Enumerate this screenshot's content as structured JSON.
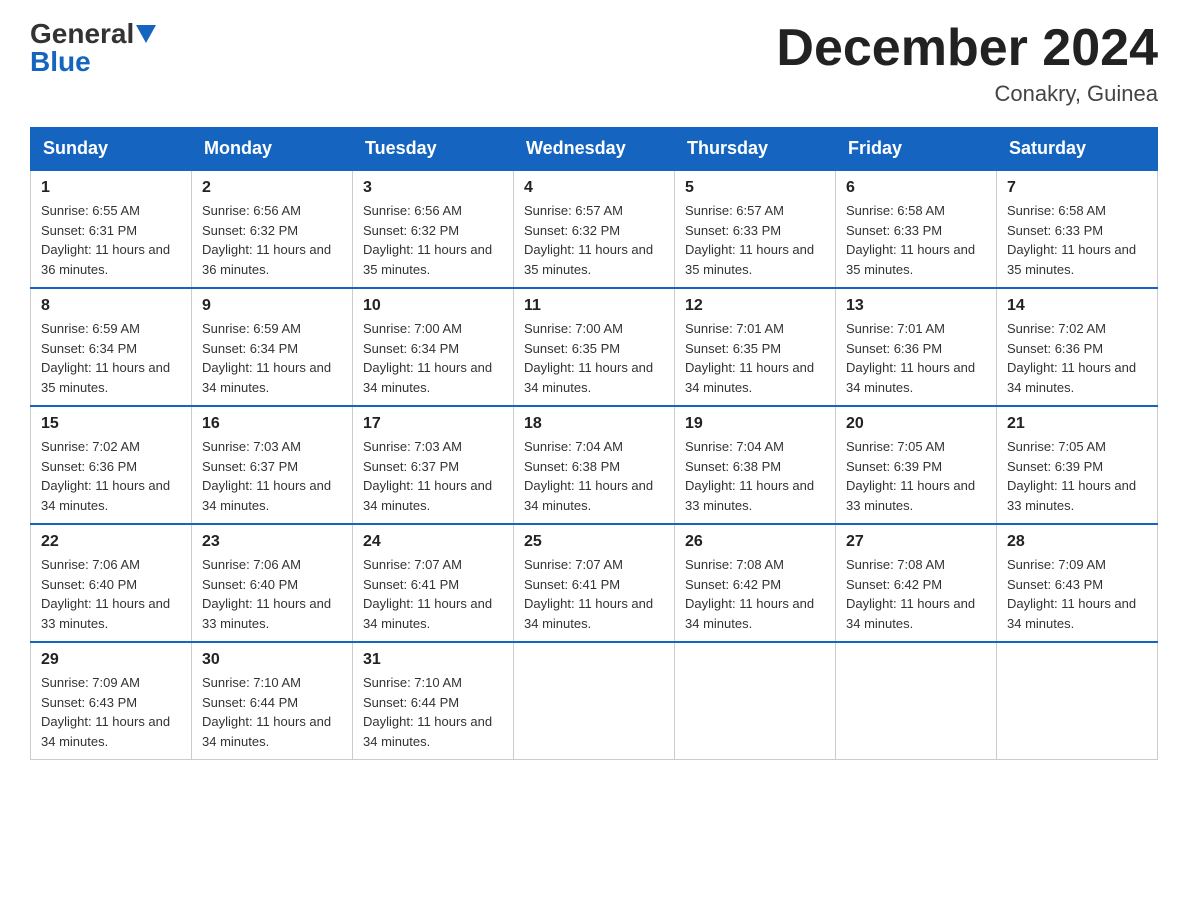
{
  "header": {
    "logo_general": "General",
    "logo_blue": "Blue",
    "month_title": "December 2024",
    "location": "Conakry, Guinea"
  },
  "days_of_week": [
    "Sunday",
    "Monday",
    "Tuesday",
    "Wednesday",
    "Thursday",
    "Friday",
    "Saturday"
  ],
  "weeks": [
    [
      {
        "day": "1",
        "sunrise": "6:55 AM",
        "sunset": "6:31 PM",
        "daylight": "11 hours and 36 minutes."
      },
      {
        "day": "2",
        "sunrise": "6:56 AM",
        "sunset": "6:32 PM",
        "daylight": "11 hours and 36 minutes."
      },
      {
        "day": "3",
        "sunrise": "6:56 AM",
        "sunset": "6:32 PM",
        "daylight": "11 hours and 35 minutes."
      },
      {
        "day": "4",
        "sunrise": "6:57 AM",
        "sunset": "6:32 PM",
        "daylight": "11 hours and 35 minutes."
      },
      {
        "day": "5",
        "sunrise": "6:57 AM",
        "sunset": "6:33 PM",
        "daylight": "11 hours and 35 minutes."
      },
      {
        "day": "6",
        "sunrise": "6:58 AM",
        "sunset": "6:33 PM",
        "daylight": "11 hours and 35 minutes."
      },
      {
        "day": "7",
        "sunrise": "6:58 AM",
        "sunset": "6:33 PM",
        "daylight": "11 hours and 35 minutes."
      }
    ],
    [
      {
        "day": "8",
        "sunrise": "6:59 AM",
        "sunset": "6:34 PM",
        "daylight": "11 hours and 35 minutes."
      },
      {
        "day": "9",
        "sunrise": "6:59 AM",
        "sunset": "6:34 PM",
        "daylight": "11 hours and 34 minutes."
      },
      {
        "day": "10",
        "sunrise": "7:00 AM",
        "sunset": "6:34 PM",
        "daylight": "11 hours and 34 minutes."
      },
      {
        "day": "11",
        "sunrise": "7:00 AM",
        "sunset": "6:35 PM",
        "daylight": "11 hours and 34 minutes."
      },
      {
        "day": "12",
        "sunrise": "7:01 AM",
        "sunset": "6:35 PM",
        "daylight": "11 hours and 34 minutes."
      },
      {
        "day": "13",
        "sunrise": "7:01 AM",
        "sunset": "6:36 PM",
        "daylight": "11 hours and 34 minutes."
      },
      {
        "day": "14",
        "sunrise": "7:02 AM",
        "sunset": "6:36 PM",
        "daylight": "11 hours and 34 minutes."
      }
    ],
    [
      {
        "day": "15",
        "sunrise": "7:02 AM",
        "sunset": "6:36 PM",
        "daylight": "11 hours and 34 minutes."
      },
      {
        "day": "16",
        "sunrise": "7:03 AM",
        "sunset": "6:37 PM",
        "daylight": "11 hours and 34 minutes."
      },
      {
        "day": "17",
        "sunrise": "7:03 AM",
        "sunset": "6:37 PM",
        "daylight": "11 hours and 34 minutes."
      },
      {
        "day": "18",
        "sunrise": "7:04 AM",
        "sunset": "6:38 PM",
        "daylight": "11 hours and 34 minutes."
      },
      {
        "day": "19",
        "sunrise": "7:04 AM",
        "sunset": "6:38 PM",
        "daylight": "11 hours and 33 minutes."
      },
      {
        "day": "20",
        "sunrise": "7:05 AM",
        "sunset": "6:39 PM",
        "daylight": "11 hours and 33 minutes."
      },
      {
        "day": "21",
        "sunrise": "7:05 AM",
        "sunset": "6:39 PM",
        "daylight": "11 hours and 33 minutes."
      }
    ],
    [
      {
        "day": "22",
        "sunrise": "7:06 AM",
        "sunset": "6:40 PM",
        "daylight": "11 hours and 33 minutes."
      },
      {
        "day": "23",
        "sunrise": "7:06 AM",
        "sunset": "6:40 PM",
        "daylight": "11 hours and 33 minutes."
      },
      {
        "day": "24",
        "sunrise": "7:07 AM",
        "sunset": "6:41 PM",
        "daylight": "11 hours and 34 minutes."
      },
      {
        "day": "25",
        "sunrise": "7:07 AM",
        "sunset": "6:41 PM",
        "daylight": "11 hours and 34 minutes."
      },
      {
        "day": "26",
        "sunrise": "7:08 AM",
        "sunset": "6:42 PM",
        "daylight": "11 hours and 34 minutes."
      },
      {
        "day": "27",
        "sunrise": "7:08 AM",
        "sunset": "6:42 PM",
        "daylight": "11 hours and 34 minutes."
      },
      {
        "day": "28",
        "sunrise": "7:09 AM",
        "sunset": "6:43 PM",
        "daylight": "11 hours and 34 minutes."
      }
    ],
    [
      {
        "day": "29",
        "sunrise": "7:09 AM",
        "sunset": "6:43 PM",
        "daylight": "11 hours and 34 minutes."
      },
      {
        "day": "30",
        "sunrise": "7:10 AM",
        "sunset": "6:44 PM",
        "daylight": "11 hours and 34 minutes."
      },
      {
        "day": "31",
        "sunrise": "7:10 AM",
        "sunset": "6:44 PM",
        "daylight": "11 hours and 34 minutes."
      },
      null,
      null,
      null,
      null
    ]
  ]
}
